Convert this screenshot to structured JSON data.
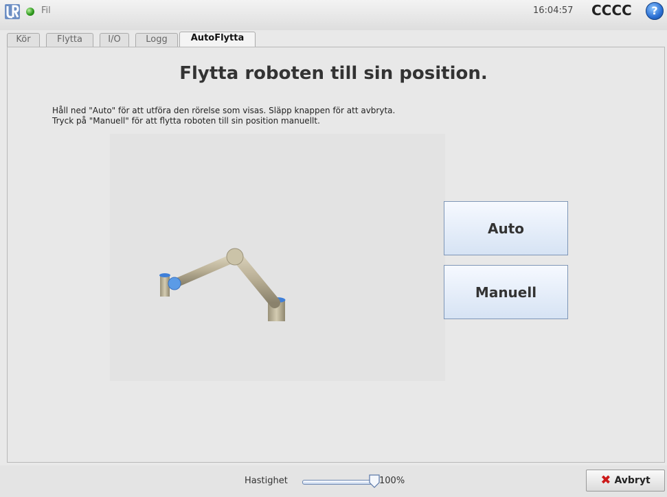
{
  "header": {
    "menu_file": "Fil",
    "time": "16:04:57",
    "robot_name": "CCCC",
    "help_label": "?"
  },
  "tabs": [
    {
      "label": "Kör"
    },
    {
      "label": "Flytta"
    },
    {
      "label": "I/O"
    },
    {
      "label": "Logg"
    },
    {
      "label": "AutoFlytta",
      "active": true
    }
  ],
  "main": {
    "title": "Flytta roboten till sin position.",
    "instructions": [
      "Håll ned \"Auto\" för att utföra den rörelse som visas. Släpp knappen för att avbryta.",
      "Tryck på \"Manuell\" för att flytta roboten till sin position manuellt."
    ],
    "auto_label": "Auto",
    "manual_label": "Manuell"
  },
  "footer": {
    "speed_label": "Hastighet",
    "speed_value": "100%",
    "speed_fraction": 1.0,
    "cancel_label": "Avbryt"
  },
  "colors": {
    "status_ok": "#2f9a1e",
    "button_border": "#7d95b6",
    "cancel_icon": "#cc1a1a"
  },
  "icons": {
    "logo": "ur-logo-icon",
    "status": "status-dot-icon",
    "help": "help-icon",
    "cancel": "close-icon"
  }
}
